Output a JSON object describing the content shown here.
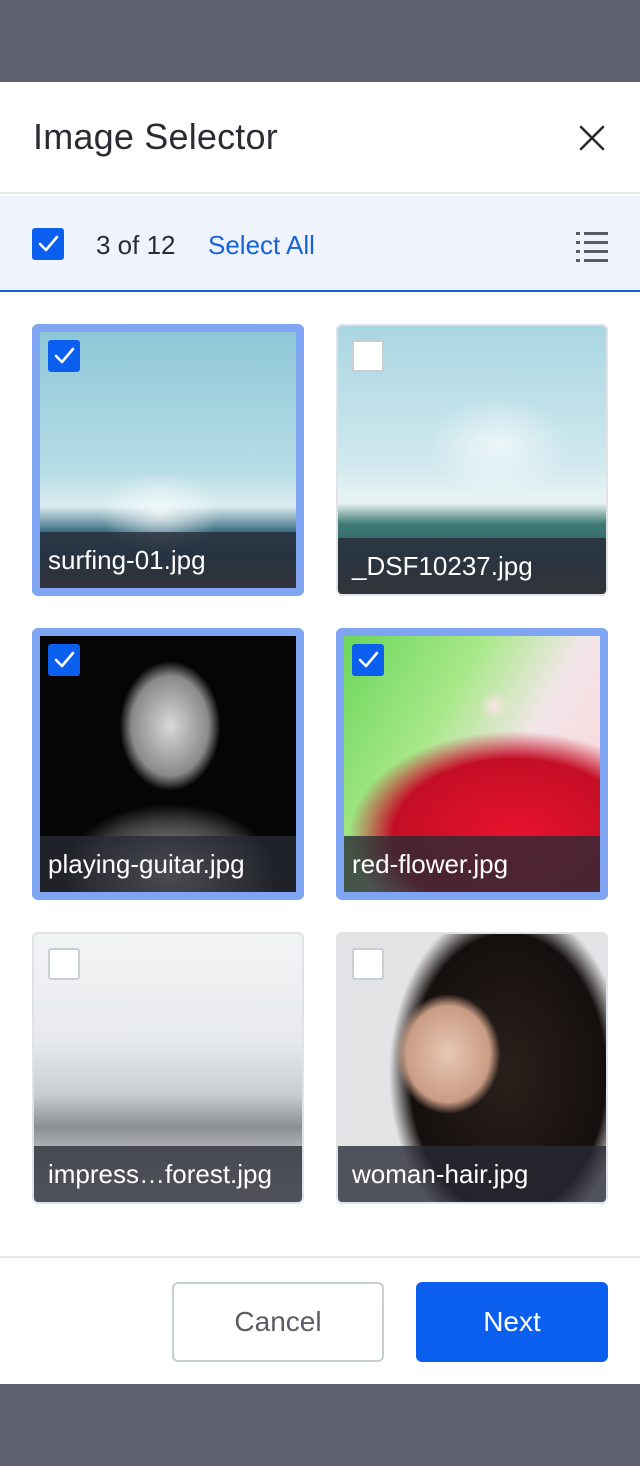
{
  "dialog": {
    "title": "Image Selector"
  },
  "toolbar": {
    "all_checked": true,
    "count_text": "3 of 12",
    "select_all_label": "Select All"
  },
  "images": [
    {
      "filename": "surfing-01.jpg",
      "selected": true
    },
    {
      "filename": "_DSF10237.jpg",
      "selected": false
    },
    {
      "filename": "playing-guitar.jpg",
      "selected": true
    },
    {
      "filename": "red-flower.jpg",
      "selected": true
    },
    {
      "filename": "impress…forest.jpg",
      "selected": false
    },
    {
      "filename": "woman-hair.jpg",
      "selected": false
    }
  ],
  "footer": {
    "cancel_label": "Cancel",
    "next_label": "Next"
  },
  "colors": {
    "accent": "#0b5fef",
    "link": "#1565d8",
    "selected_border": "#7fa4f1",
    "overlay": "#5f6070"
  },
  "icons": {
    "close": "close-icon",
    "check": "checkmark-icon",
    "list_view": "list-view-icon"
  }
}
